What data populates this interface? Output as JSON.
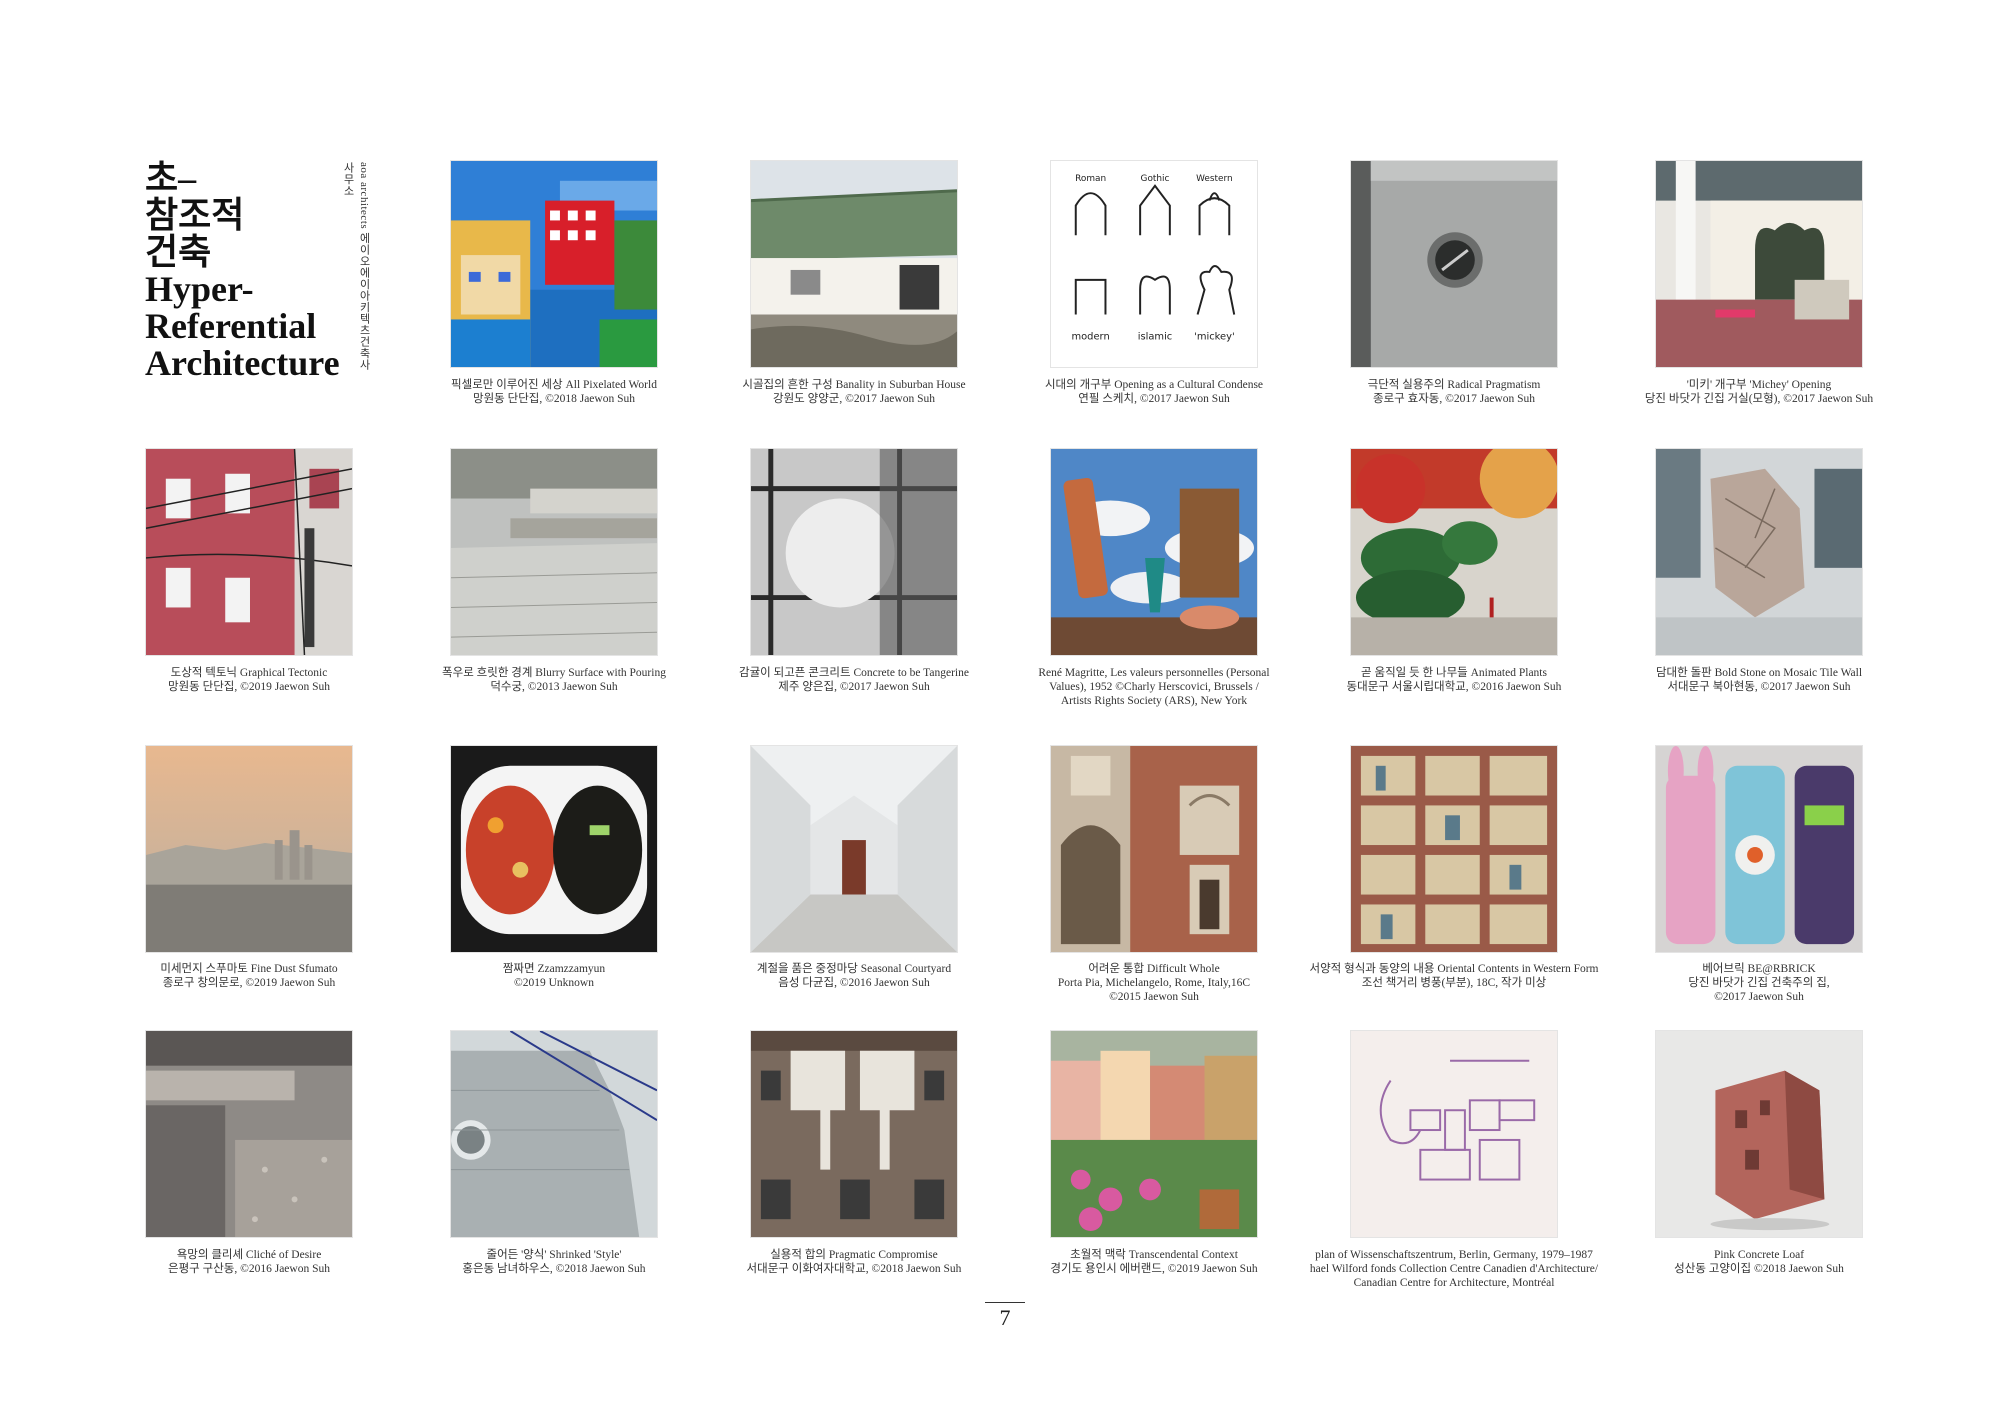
{
  "title": {
    "lines": [
      "초–",
      "참조적",
      "건축",
      "Hyper-",
      "Referential",
      "Architecture"
    ],
    "side_label": "aoa architects 에이오에이아키텍츠건축사사무소"
  },
  "page_number": "7",
  "grid": [
    {
      "icon": "pixelated-world-image",
      "lines": [
        "픽셀로만 이루어진 세상 All Pixelated World",
        "망원동 단단집, ©2018 Jaewon Suh"
      ]
    },
    {
      "icon": "suburban-house-image",
      "lines": [
        "시골집의 흔한 구성 Banality in Suburban House",
        "강원도 양양군, ©2017 Jaewon Suh"
      ]
    },
    {
      "icon": "opening-sketch-image",
      "lines": [
        "시대의 개구부 Opening as a Cultural Condense",
        "연필 스케치, ©2017 Jaewon Suh"
      ],
      "sketch": {
        "top": [
          "Roman",
          "Gothic",
          "Western"
        ],
        "bottom": [
          "modern",
          "islamic",
          "'mickey'"
        ]
      }
    },
    {
      "icon": "concrete-wall-image",
      "lines": [
        "극단적 실용주의 Radical Pragmatism",
        "종로구 효자동, ©2017 Jaewon Suh"
      ]
    },
    {
      "icon": "mickey-opening-image",
      "lines": [
        "'미키' 개구부 'Michey' Opening",
        "당진 바닷가 긴집 거실(모형), ©2017 Jaewon Suh"
      ]
    },
    {
      "icon": "red-tile-building-image",
      "lines": [
        "도상적 텍토닉 Graphical Tectonic",
        "망원동 단단집, ©2019 Jaewon Suh"
      ]
    },
    {
      "icon": "stone-steps-image",
      "lines": [
        "폭우로 흐릿한 경계 Blurry Surface with Pouring",
        "덕수궁, ©2013 Jaewon Suh"
      ]
    },
    {
      "icon": "concrete-circle-image",
      "lines": [
        "감귤이 되고픈 콘크리트 Concrete to be Tangerine",
        "제주 양은집, ©2017 Jaewon Suh"
      ]
    },
    {
      "icon": "magritte-painting-image",
      "lines": [
        "René Magritte, Les valeurs personnelles (Personal",
        "Values), 1952 ©Charly Herscovici, Brussels /",
        "Artists Rights Society (ARS), New York"
      ]
    },
    {
      "icon": "animated-plants-image",
      "lines": [
        "곧 움직일 듯 한 나무들 Animated Plants",
        "동대문구 서울시립대학교, ©2016 Jaewon Suh"
      ]
    },
    {
      "icon": "mosaic-stone-wall-image",
      "lines": [
        "담대한 돌판 Bold Stone on Mosaic Tile Wall",
        "서대문구 북아현동, ©2017 Jaewon Suh"
      ]
    },
    {
      "icon": "fine-dust-skyline-image",
      "lines": [
        "미세먼지 스푸마토 Fine Dust Sfumato",
        "종로구 창의문로, ©2019 Jaewon Suh"
      ]
    },
    {
      "icon": "zzamzzamyun-image",
      "lines": [
        "짬짜면 Zzamzzamyun",
        "©2019 Unknown"
      ]
    },
    {
      "icon": "seasonal-courtyard-image",
      "lines": [
        "계절을 품은 중정마당 Seasonal Courtyard",
        "음성 다균집, ©2016 Jaewon Suh"
      ]
    },
    {
      "icon": "porta-pia-image",
      "lines": [
        "어려운 통합 Difficult Whole",
        "Porta Pia, Michelangelo, Rome, Italy,16C",
        "©2015 Jaewon Suh"
      ]
    },
    {
      "icon": "chaekgeori-image",
      "lines": [
        "서양적 형식과 동양의 내용 Oriental Contents in Western Form",
        "조선 책거리 병풍(부분), 18C, 작가 미상"
      ]
    },
    {
      "icon": "bearbrick-image",
      "lines": [
        "베어브릭 BE@RBRICK",
        "당진 바닷가 긴집 건축주의 집,",
        "©2017 Jaewon Suh"
      ]
    },
    {
      "icon": "granite-cliche-image",
      "lines": [
        "욕망의 클리셰 Cliché of Desire",
        "은평구 구산동, ©2016 Jaewon Suh"
      ]
    },
    {
      "icon": "shrinked-style-image",
      "lines": [
        "줄어든 '양식' Shrinked 'Style'",
        "홍은동 남녀하우스, ©2018 Jaewon Suh"
      ]
    },
    {
      "icon": "pragmatic-compromise-image",
      "lines": [
        "실용적 합의 Pragmatic Compromise",
        "서대문구 이화여자대학교, ©2018 Jaewon Suh"
      ]
    },
    {
      "icon": "transcendental-context-image",
      "lines": [
        "초월적 맥락 Transcendental Context",
        "경기도 용인시 에버랜드, ©2019 Jaewon Suh"
      ]
    },
    {
      "icon": "wissenschaftszentrum-plan-image",
      "lines": [
        "plan of Wissenschaftszentrum, Berlin, Germany, 1979–1987",
        "hael Wilford fonds Collection Centre Canadien d'Architecture/",
        "Canadian Centre for Architecture, Montréal"
      ]
    },
    {
      "icon": "pink-concrete-loaf-image",
      "lines": [
        "Pink Concrete Loaf",
        "성산동 고양이집 ©2018 Jaewon Suh"
      ]
    }
  ]
}
